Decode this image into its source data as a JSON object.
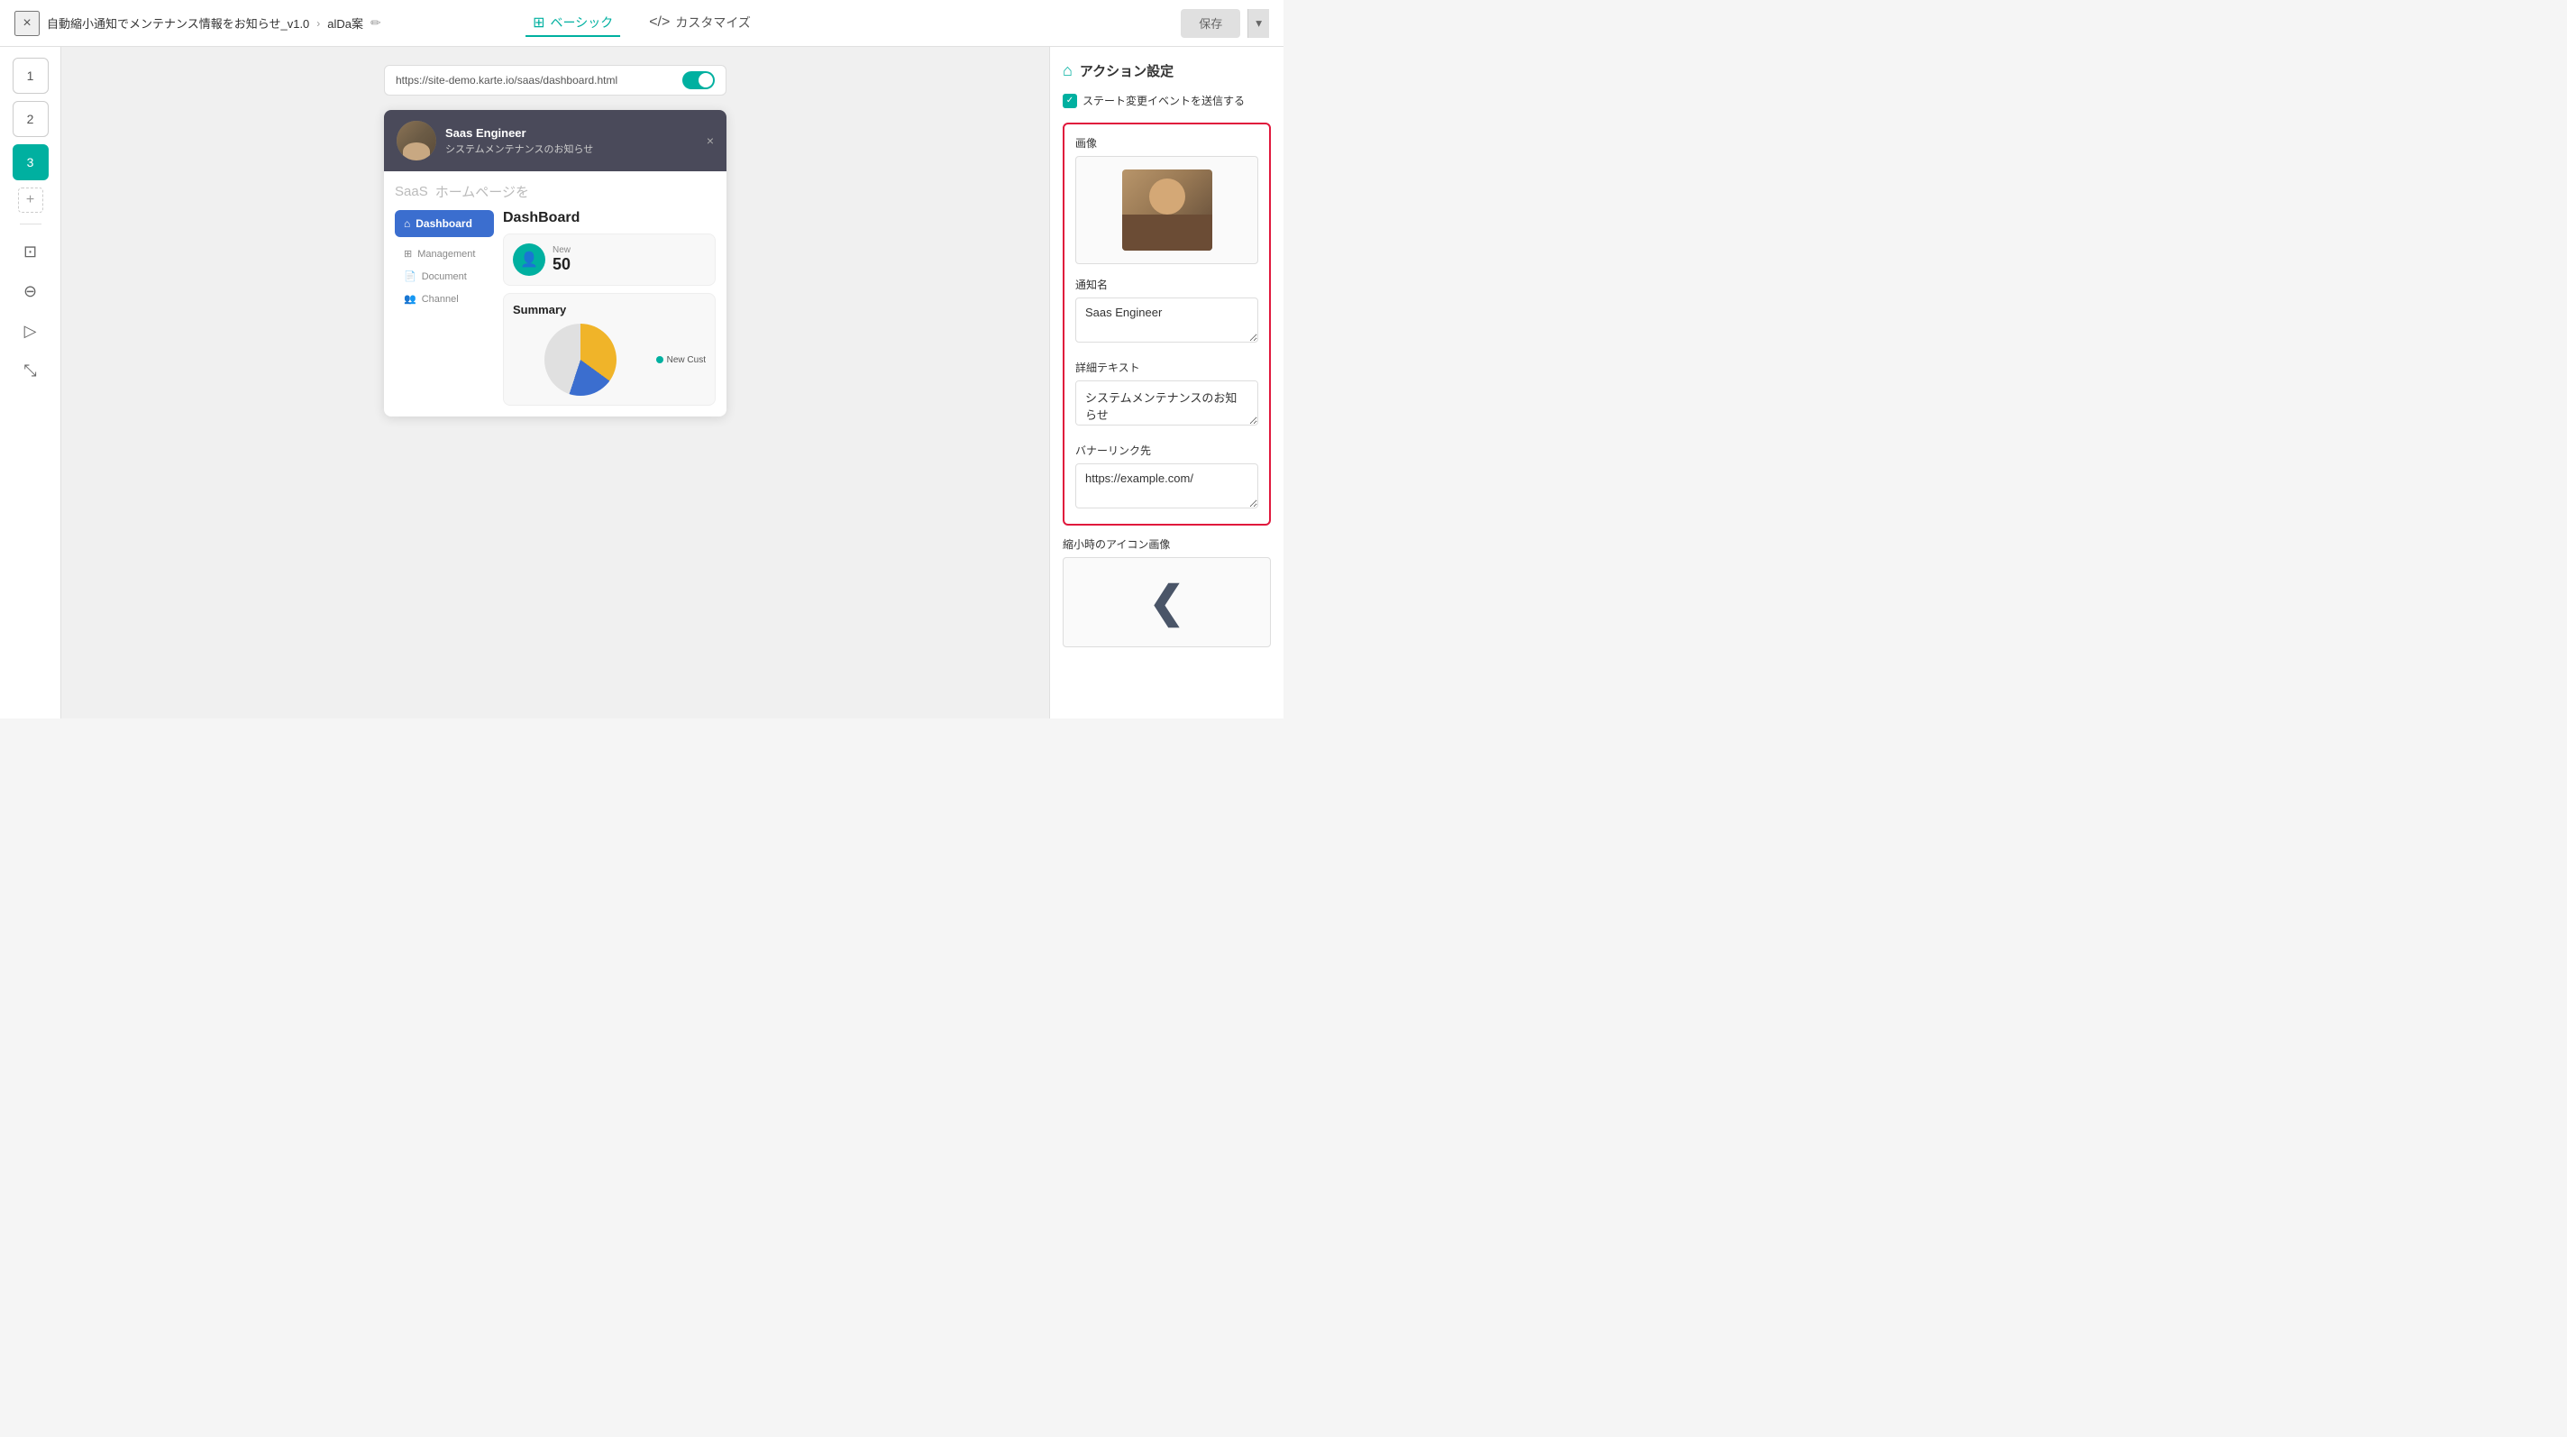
{
  "topbar": {
    "close_label": "×",
    "breadcrumb": "自動縮小通知でメンテナンス情報をお知らせ_v1.0",
    "breadcrumb_arrow": "›",
    "project_name": "alDa案",
    "edit_icon": "✏",
    "tab_basic_label": "ベーシック",
    "tab_basic_icon": "⊞",
    "tab_custom_label": "カスタマイズ",
    "tab_custom_icon": "</>",
    "save_label": "保存",
    "save_dropdown_icon": "▾"
  },
  "steps": {
    "step1_label": "1",
    "step2_label": "2",
    "step3_label": "3",
    "add_step_icon": "+",
    "tool_layout": "⊡",
    "tool_tags": "⊖",
    "tool_video": "▷",
    "tool_expand": "⤡"
  },
  "url_bar": {
    "url": "https://site-demo.karte.io/saas/dashboard.html"
  },
  "notification": {
    "title": "Saas Engineer",
    "description": "システムメンテナンスのお知らせ",
    "close_icon": "×"
  },
  "saas_content": {
    "title": "SaaS",
    "subtitle": "ホームページを",
    "nav_dashboard": "Dashboard",
    "nav_management": "Management",
    "nav_document": "Document",
    "nav_channel": "Channel",
    "dashboard_title": "DashBoard",
    "stat_label": "New",
    "stat_value": "50",
    "summary_title": "Summary",
    "legend_label": "New Cust"
  },
  "right_panel": {
    "title": "アクション設定",
    "home_icon": "⌂",
    "checkbox_label": "ステート変更イベントを送信する",
    "image_section_label": "画像",
    "notification_name_label": "通知名",
    "notification_name_value": "Saas Engineer",
    "detail_text_label": "詳細テキスト",
    "detail_text_value": "システムメンテナンスのお知らせ",
    "banner_link_label": "バナーリンク先",
    "banner_link_value": "https://example.com/",
    "mini_icon_label": "縮小時のアイコン画像"
  },
  "colors": {
    "accent": "#00b0a0",
    "danger": "#e0183c",
    "nav_blue": "#3b6ecf"
  }
}
